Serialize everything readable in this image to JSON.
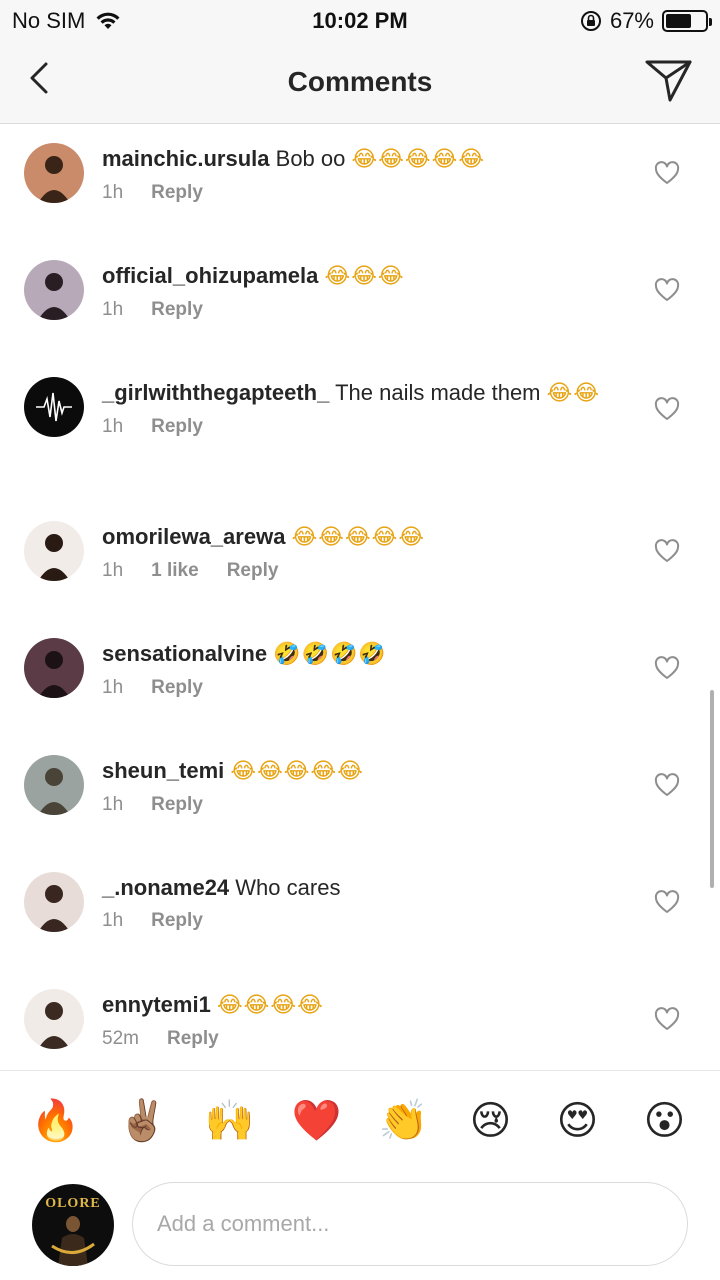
{
  "status_bar": {
    "carrier": "No SIM",
    "time": "10:02 PM",
    "battery_percent": "67%",
    "battery_level": 0.67
  },
  "header": {
    "title": "Comments"
  },
  "comments": [
    {
      "username": "mainchic.ursula",
      "text": "Bob oo",
      "emoji": "😂😂😂😂😂",
      "time": "1h",
      "likes": "",
      "reply": "Reply"
    },
    {
      "username": "official_ohizupamela",
      "text": "",
      "emoji": "😂😂😂",
      "time": "1h",
      "likes": "",
      "reply": "Reply"
    },
    {
      "username": "_girlwiththegapteeth_",
      "text": "The nails made them",
      "emoji": "😂😂",
      "time": "1h",
      "likes": "",
      "reply": "Reply"
    },
    {
      "username": "omorilewa_arewa",
      "text": "",
      "emoji": "😂😂😂😂😂",
      "time": "1h",
      "likes": "1 like",
      "reply": "Reply"
    },
    {
      "username": "sensationalvine",
      "text": "",
      "emoji": "🤣🤣🤣🤣",
      "time": "1h",
      "likes": "",
      "reply": "Reply"
    },
    {
      "username": "sheun_temi",
      "text": "",
      "emoji": "😂😂😂😂😂",
      "time": "1h",
      "likes": "",
      "reply": "Reply"
    },
    {
      "username": "_.noname24",
      "text": "Who cares",
      "emoji": "",
      "time": "1h",
      "likes": "",
      "reply": "Reply"
    },
    {
      "username": "ennytemi1",
      "text": "",
      "emoji": "😂😂😂😂",
      "time": "52m",
      "likes": "",
      "reply": "Reply"
    }
  ],
  "reactions": [
    {
      "name": "fire",
      "glyph": "🔥"
    },
    {
      "name": "victory-hand",
      "glyph": "✌🏽"
    },
    {
      "name": "raising-hands",
      "glyph": "🙌"
    },
    {
      "name": "red-heart",
      "glyph": "❤️"
    },
    {
      "name": "clapping-hands",
      "glyph": "👏"
    },
    {
      "name": "crying-face",
      "glyph": "😢"
    },
    {
      "name": "heart-eyes",
      "glyph": "😍"
    },
    {
      "name": "surprised-face",
      "glyph": "😮"
    }
  ],
  "composer": {
    "avatar_text": "OLORE",
    "placeholder": "Add a comment..."
  },
  "colors": {
    "text": "#262626",
    "meta": "#8e8e8e",
    "bar_bg": "#f7f7f7",
    "border": "#dbdbdb"
  }
}
